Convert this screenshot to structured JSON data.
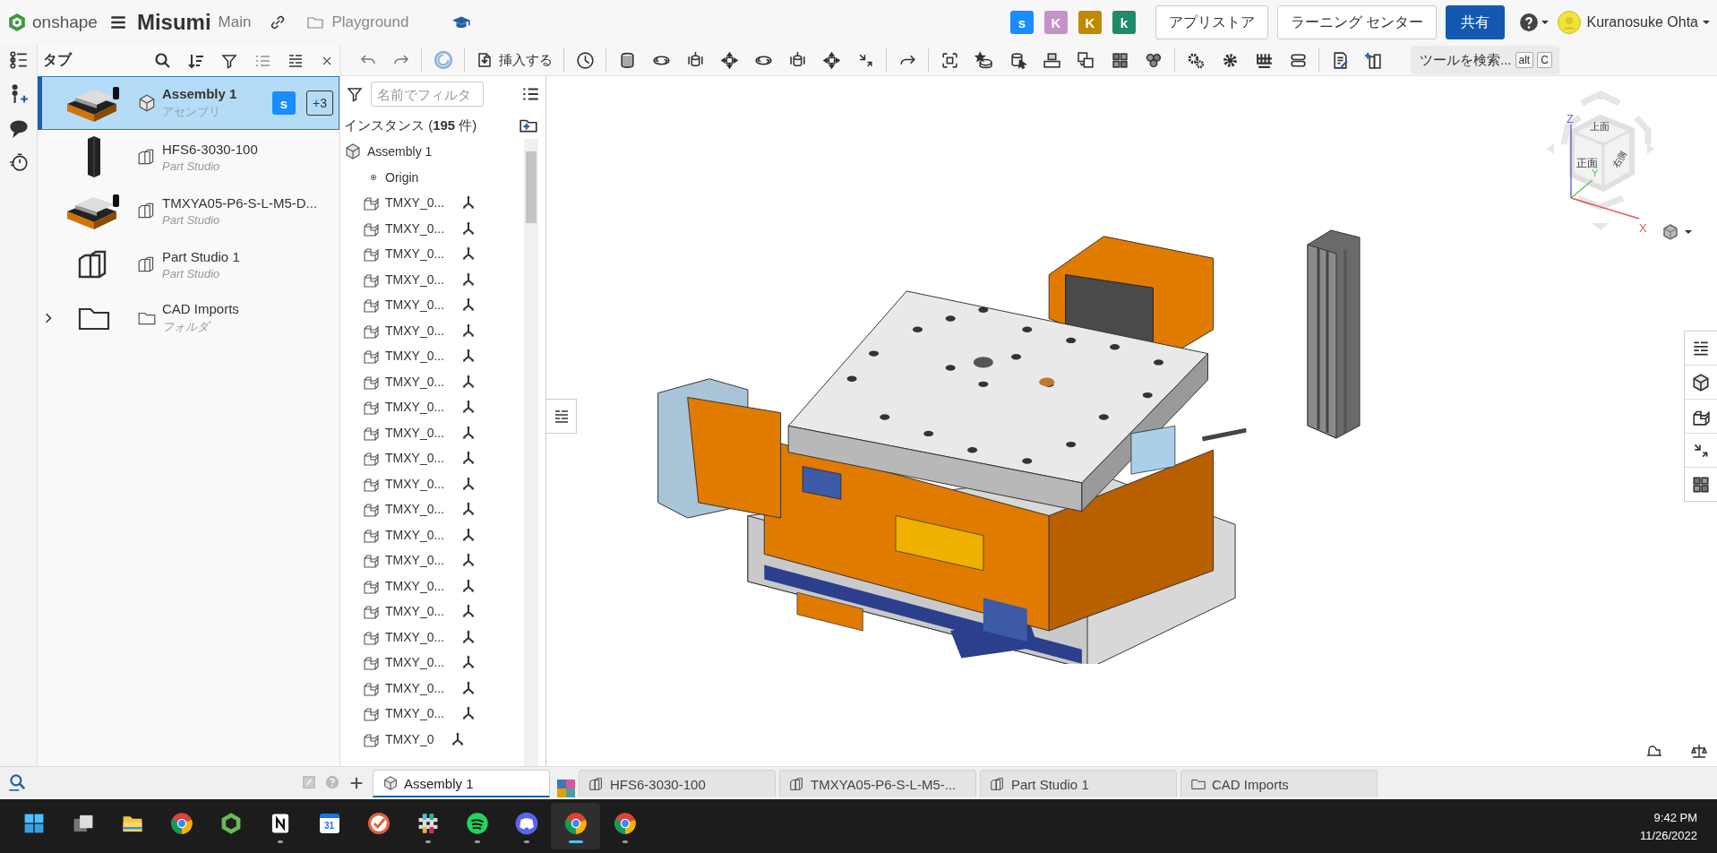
{
  "topbar": {
    "logo": "onshape",
    "document": "Misumi",
    "workspace": "Main",
    "folder": "Playground",
    "collaborators": [
      {
        "initial": "s",
        "color": "#1a8cff"
      },
      {
        "initial": "K",
        "color": "#c493c7"
      },
      {
        "initial": "K",
        "color": "#bf8a00"
      },
      {
        "initial": "k",
        "color": "#1e8c6a"
      }
    ],
    "buttons": [
      {
        "label": "アプリストア",
        "kind": "outline"
      },
      {
        "label": "ラーニング センター",
        "kind": "outline"
      },
      {
        "label": "共有",
        "kind": "primary"
      }
    ],
    "user": "Kuranosuke Ohta"
  },
  "tabs_panel": {
    "title": "タブ",
    "items": [
      {
        "name": "Assembly 1",
        "subtitle": "アセンブリ",
        "kind": "assembly",
        "thumbnail": {
          "kind": "model"
        },
        "selected": true,
        "collaborator": {
          "initial": "s",
          "color": "#1a8cff"
        },
        "more": "+3"
      },
      {
        "name": "HFS6-3030-100",
        "subtitle": "Part Studio",
        "kind": "part_studio",
        "thumbnail": {
          "kind": "profile"
        },
        "selected": false
      },
      {
        "name": "TMXYA05-P6-S-L-M5-D...",
        "subtitle": "Part Studio",
        "kind": "part_studio",
        "thumbnail": {
          "kind": "model"
        },
        "selected": false
      },
      {
        "name": "Part Studio 1",
        "subtitle": "Part Studio",
        "kind": "part_studio",
        "thumbnail": {
          "kind": "part_studio"
        },
        "selected": false
      },
      {
        "name": "CAD Imports",
        "subtitle": "フォルダ",
        "kind": "folder",
        "thumbnail": {
          "kind": "folder"
        },
        "selected": false
      }
    ]
  },
  "toolbar": {
    "insert_label": "挿入する",
    "search_label": "ツールを検索...",
    "shortcut": [
      "alt",
      "C"
    ]
  },
  "instances": {
    "filter_placeholder": "名前でフィルタ",
    "heading": "インスタンス (**195** 件)",
    "items": [
      {
        "name": "Assembly 1",
        "kind": "assembly"
      },
      {
        "name": "Origin",
        "kind": "origin"
      },
      {
        "name": "TMXY_0...",
        "kind": "part"
      },
      {
        "name": "TMXY_0...",
        "kind": "part"
      },
      {
        "name": "TMXY_0...",
        "kind": "part"
      },
      {
        "name": "TMXY_0...",
        "kind": "part"
      },
      {
        "name": "TMXY_0...",
        "kind": "part"
      },
      {
        "name": "TMXY_0...",
        "kind": "part"
      },
      {
        "name": "TMXY_0...",
        "kind": "part"
      },
      {
        "name": "TMXY_0...",
        "kind": "part"
      },
      {
        "name": "TMXY_0...",
        "kind": "part"
      },
      {
        "name": "TMXY_0...",
        "kind": "part"
      },
      {
        "name": "TMXY_0...",
        "kind": "part"
      },
      {
        "name": "TMXY_0...",
        "kind": "part"
      },
      {
        "name": "TMXY_0...",
        "kind": "part"
      },
      {
        "name": "TMXY_0...",
        "kind": "part"
      },
      {
        "name": "TMXY_0...",
        "kind": "part"
      },
      {
        "name": "TMXY_0...",
        "kind": "part"
      },
      {
        "name": "TMXY_0...",
        "kind": "part"
      },
      {
        "name": "TMXY_0...",
        "kind": "part"
      },
      {
        "name": "TMXY_0...",
        "kind": "part"
      },
      {
        "name": "TMXY_0...",
        "kind": "part"
      },
      {
        "name": "TMXY_0...",
        "kind": "part"
      },
      {
        "name": "TMXY_0",
        "kind": "part"
      }
    ]
  },
  "view_cube": {
    "faces": [
      "上面",
      "正面",
      "右側"
    ],
    "axes": [
      "Z",
      "Y",
      "X"
    ]
  },
  "document_tabs": [
    {
      "label": "Assembly 1",
      "kind": "assembly",
      "selected": true
    },
    {
      "label": "HFS6-3030-100",
      "kind": "part_studio",
      "selected": false
    },
    {
      "label": "TMXYA05-P6-S-L-M5-...",
      "kind": "part_studio",
      "selected": false
    },
    {
      "label": "Part Studio 1",
      "kind": "part_studio",
      "selected": false
    },
    {
      "label": "CAD Imports",
      "kind": "folder",
      "selected": false
    }
  ],
  "taskbar": {
    "apps": [
      {
        "kind": "start",
        "running": false,
        "active": false
      },
      {
        "kind": "taskview",
        "running": false,
        "active": false
      },
      {
        "kind": "explorer",
        "running": false,
        "active": false
      },
      {
        "kind": "browser",
        "running": false,
        "active": false
      },
      {
        "kind": "onshape",
        "running": false,
        "active": false
      },
      {
        "kind": "notion",
        "running": true,
        "active": false
      },
      {
        "kind": "calendar",
        "label": "31",
        "running": false,
        "active": false
      },
      {
        "kind": "todo",
        "running": false,
        "active": false
      },
      {
        "kind": "slack",
        "running": true,
        "active": false
      },
      {
        "kind": "spotify",
        "running": true,
        "active": false
      },
      {
        "kind": "discord",
        "running": true,
        "active": false
      },
      {
        "kind": "browser",
        "running": true,
        "active": true
      },
      {
        "kind": "browser",
        "running": true,
        "active": false
      }
    ],
    "time": "9:42 PM",
    "date": "11/26/2022"
  }
}
